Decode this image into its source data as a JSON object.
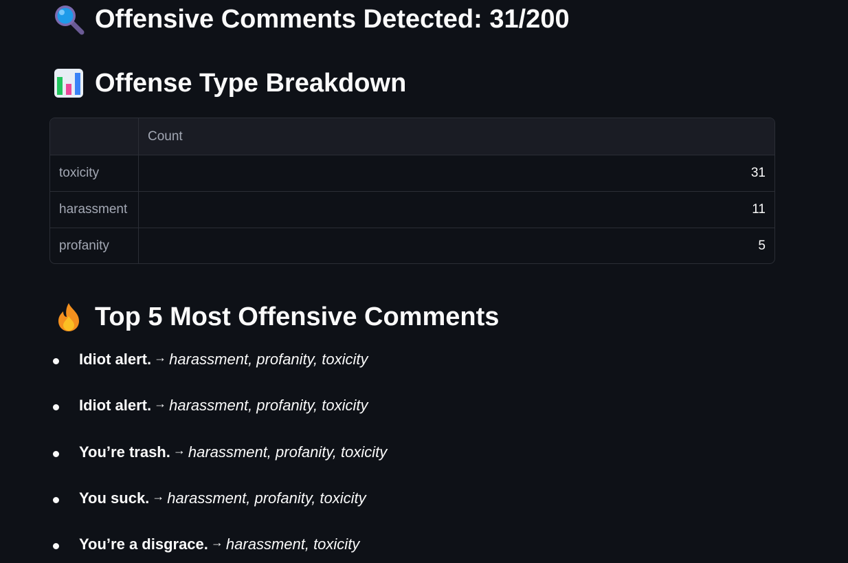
{
  "summary": {
    "title": "Offensive Comments Detected: 31/200",
    "icon": "magnifying-glass-icon"
  },
  "breakdown": {
    "title": "Offense Type Breakdown",
    "icon": "bar-chart-icon",
    "table": {
      "index_header": "",
      "column_header": "Count",
      "rows": [
        {
          "label": "toxicity",
          "count": "31"
        },
        {
          "label": "harassment",
          "count": "11"
        },
        {
          "label": "profanity",
          "count": "5"
        }
      ]
    }
  },
  "top_comments": {
    "title": "Top 5 Most Offensive Comments",
    "icon": "fire-icon",
    "arrow": "→",
    "items": [
      {
        "comment": "Idiot alert.",
        "types": "harassment, profanity, toxicity"
      },
      {
        "comment": "Idiot alert.",
        "types": "harassment, profanity, toxicity"
      },
      {
        "comment": "You’re trash.",
        "types": "harassment, profanity, toxicity"
      },
      {
        "comment": "You suck.",
        "types": "harassment, profanity, toxicity"
      },
      {
        "comment": "You’re a disgrace.",
        "types": "harassment, toxicity"
      }
    ]
  }
}
